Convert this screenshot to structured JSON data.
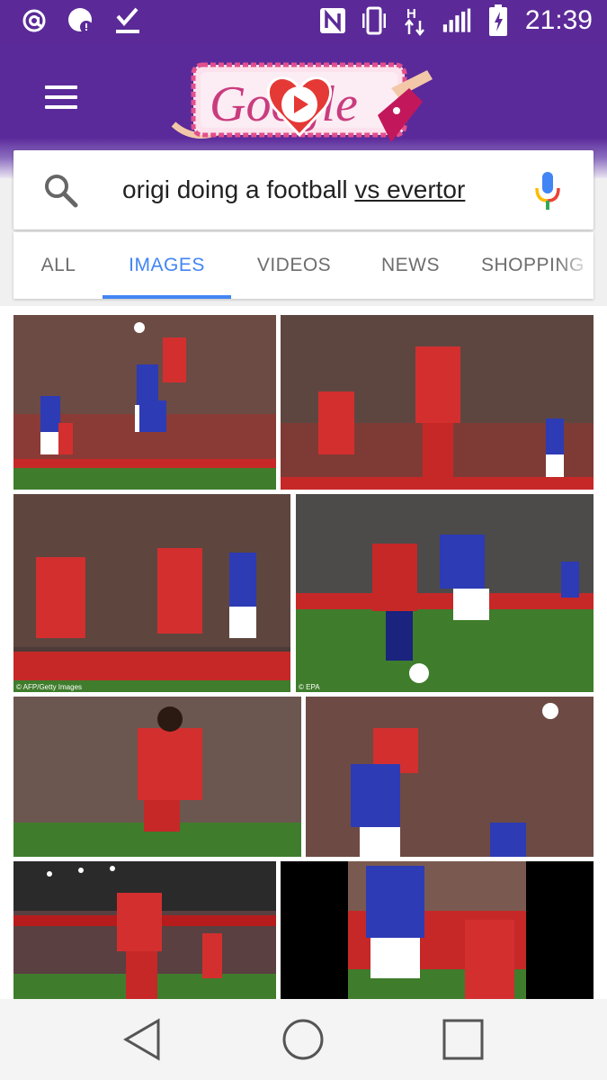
{
  "status_bar": {
    "time": "21:39",
    "left_icons": [
      "at-sign-icon",
      "notification-icon",
      "download-check-icon"
    ],
    "right_icons": [
      "nfc-icon",
      "vibrate-icon",
      "data-arrows-icon",
      "signal-icon",
      "battery-charging-icon"
    ],
    "data_label": "H"
  },
  "header": {
    "menu_icon": "hamburger-menu-icon",
    "doodle": "google-doodle-logo",
    "doodle_text": "Google"
  },
  "search": {
    "query_plain": "origi doing a football ",
    "query_suggest": "vs evertor",
    "search_icon": "search-icon",
    "mic_icon": "microphone-icon"
  },
  "tabs": [
    {
      "label": "ALL",
      "active": false
    },
    {
      "label": "IMAGES",
      "active": true
    },
    {
      "label": "VIDEOS",
      "active": false
    },
    {
      "label": "NEWS",
      "active": false
    },
    {
      "label": "SHOPPING",
      "active": false
    }
  ],
  "images": [
    {
      "alt": "Origi heading ball vs Everton defenders",
      "credit": ""
    },
    {
      "alt": "Origi celebrating with teammate",
      "credit": ""
    },
    {
      "alt": "Liverpool players celebrating goal",
      "credit": "© AFP/Getty Images"
    },
    {
      "alt": "Origi dribbling against Everton defender",
      "credit": "© EPA"
    },
    {
      "alt": "Origi running on pitch",
      "credit": ""
    },
    {
      "alt": "Origi jumping for header",
      "credit": ""
    },
    {
      "alt": "Origi celebrating at night",
      "credit": ""
    },
    {
      "alt": "Origi and Everton player close-up",
      "credit": ""
    }
  ],
  "navbar": {
    "back_icon": "back-triangle-icon",
    "home_icon": "home-circle-icon",
    "recents_icon": "recents-square-icon"
  },
  "colors": {
    "status_purple": "#5b2a98",
    "accent_blue": "#4285f4",
    "liverpool_red": "#d32f2f",
    "everton_blue": "#2d3bb5",
    "pitch_green": "#3f7d2c"
  }
}
